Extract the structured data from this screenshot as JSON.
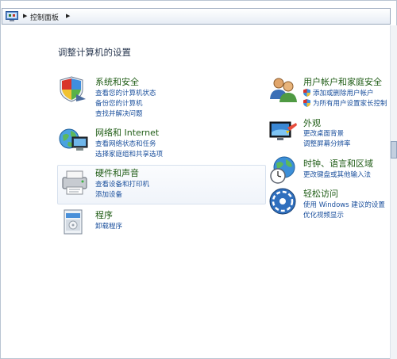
{
  "breadcrumb": {
    "item": "控制面板"
  },
  "page_title": "调整计算机的设置",
  "left_categories": [
    {
      "title": "系统和安全",
      "icon": "system-security-icon",
      "links": [
        "查看您的计算机状态",
        "备份您的计算机",
        "查找并解决问题"
      ]
    },
    {
      "title": "网络和 Internet",
      "icon": "network-internet-icon",
      "links": [
        "查看网络状态和任务",
        "选择家庭组和共享选项"
      ]
    },
    {
      "title": "硬件和声音",
      "icon": "hardware-sound-icon",
      "links": [
        "查看设备和打印机",
        "添加设备"
      ]
    },
    {
      "title": "程序",
      "icon": "programs-icon",
      "links": [
        "卸载程序"
      ]
    }
  ],
  "right_categories": [
    {
      "title": "用户帐户和家庭安全",
      "icon": "user-accounts-icon",
      "links": [
        "添加或删除用户帐户",
        "为所有用户设置家长控制"
      ]
    },
    {
      "title": "外观",
      "icon": "appearance-icon",
      "links": [
        "更改桌面背景",
        "调整屏幕分辨率"
      ]
    },
    {
      "title": "时钟、语言和区域",
      "icon": "clock-language-region-icon",
      "links": [
        "更改键盘或其他输入法"
      ]
    },
    {
      "title": "轻松访问",
      "icon": "ease-of-access-icon",
      "links": [
        "使用 Windows 建议的设置",
        "优化视频显示"
      ]
    }
  ],
  "colors": {
    "title_green": "#1e5b14",
    "link_blue": "#1a4f9c",
    "heading": "#2b3a52"
  }
}
